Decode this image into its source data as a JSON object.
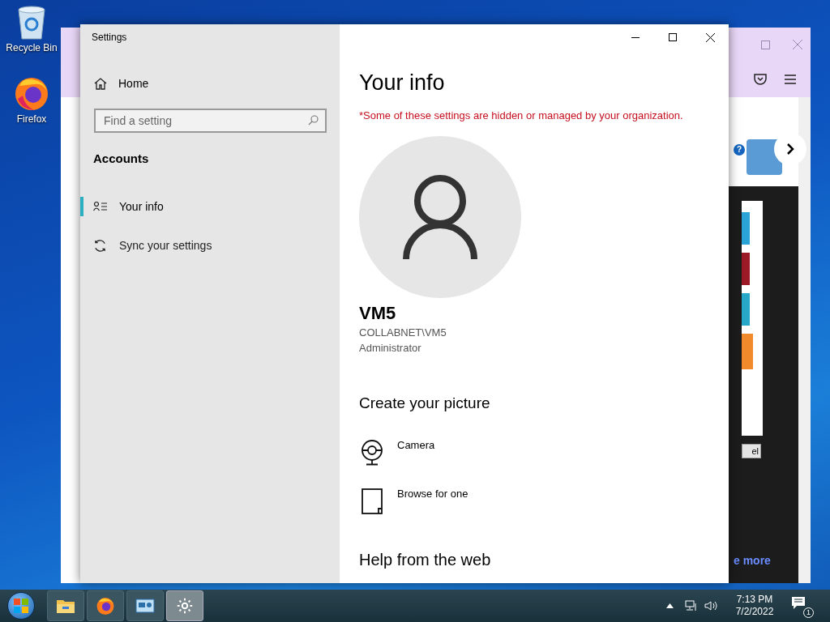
{
  "desktop_icons": [
    {
      "label": "Recycle Bin",
      "kind": "recycle"
    },
    {
      "label": "Firefox",
      "kind": "firefox"
    }
  ],
  "browser": {
    "help_mark": "?",
    "button": "el",
    "link": "e more"
  },
  "settings": {
    "title": "Settings",
    "nav": {
      "home": "Home",
      "search": {
        "placeholder": "Find a setting"
      },
      "section": "Accounts",
      "items": [
        {
          "label": "Your info",
          "kind": "info",
          "selected": true
        },
        {
          "label": "Sync your settings",
          "kind": "sync",
          "selected": false
        }
      ]
    },
    "page": {
      "title": "Your info",
      "notice": "*Some of these settings are hidden or managed by your organization.",
      "user": {
        "name": "VM5",
        "account": "COLLABNET\\VM5",
        "role": "Administrator"
      },
      "picture_heading": "Create your picture",
      "picture_options": [
        {
          "label": "Camera",
          "kind": "camera"
        },
        {
          "label": "Browse for one",
          "kind": "browse"
        }
      ],
      "help_heading": "Help from the web"
    }
  },
  "taskbar": {
    "apps": [
      {
        "kind": "explorer",
        "selected": false
      },
      {
        "kind": "firefox",
        "selected": false
      },
      {
        "kind": "control",
        "selected": false
      },
      {
        "kind": "settings",
        "selected": true
      }
    ],
    "clock": {
      "time": "7:13 PM",
      "date": "7/2/2022"
    },
    "notifications": "1"
  }
}
